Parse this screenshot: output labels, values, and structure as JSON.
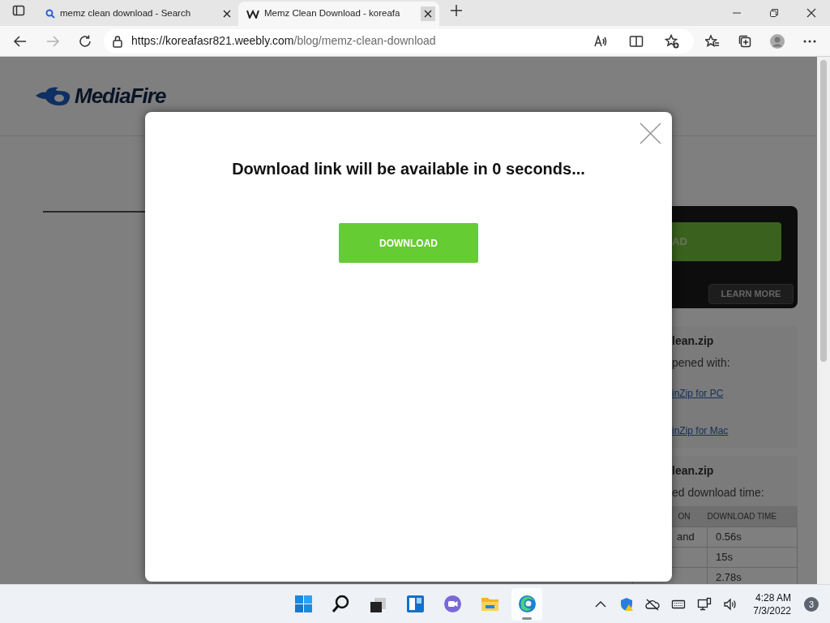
{
  "browser": {
    "tabs": [
      {
        "title": "memz clean download - Search",
        "kind": "search",
        "selected": false
      },
      {
        "title": "Memz Clean Download - koreafa",
        "kind": "site",
        "selected": true
      }
    ],
    "address": {
      "url_host": "https://koreafasr821.weebly.com",
      "url_path": "/blog/memz-clean-download"
    }
  },
  "page": {
    "logo": "MediaFire",
    "side": {
      "download_button": "AD",
      "learn_more": "LEARN MORE",
      "file_box": {
        "title": "lean.zip",
        "text": "pened with:",
        "links": [
          "inZip for PC",
          "inZip for Mac"
        ]
      },
      "time_box": {
        "title": "lean.zip",
        "text": "ed download time:",
        "columns": [
          "ON",
          "DOWNLOAD TIME"
        ],
        "rows": [
          {
            "col_1": "and",
            "time": "0.56s"
          },
          {
            "time": "15s"
          },
          {
            "time": "2.78s"
          }
        ]
      }
    }
  },
  "modal": {
    "message": "Download link will be available in 0 seconds...",
    "button": "DOWNLOAD"
  },
  "taskbar": {
    "apps": [
      {
        "kind": "start",
        "active": false
      },
      {
        "kind": "search",
        "active": false
      },
      {
        "kind": "taskview",
        "active": false
      },
      {
        "kind": "widgets",
        "active": false
      },
      {
        "kind": "chat",
        "active": false
      },
      {
        "kind": "files",
        "active": false
      },
      {
        "kind": "edge",
        "active": true
      }
    ],
    "time": "4:28 AM",
    "date": "7/3/2022",
    "notifications": "3"
  }
}
